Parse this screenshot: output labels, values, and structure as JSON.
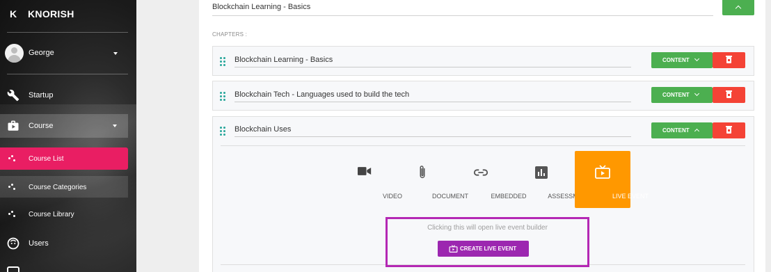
{
  "sidebar": {
    "brand_letter": "K",
    "brand_name": "KNORISH",
    "user_name": "George",
    "items": [
      {
        "label": "Startup",
        "icon": "wrench-icon"
      },
      {
        "label": "Course",
        "icon": "course-icon"
      },
      {
        "label": "Course List",
        "icon": "scatter-dots-icon"
      },
      {
        "label": "Course Categories",
        "icon": "scatter-dots-icon"
      },
      {
        "label": "Course Library",
        "icon": "scatter-dots-icon"
      },
      {
        "label": "Users",
        "icon": "face-icon"
      }
    ]
  },
  "main": {
    "course_title": "Blockchain Learning - Basics",
    "chapters_label": "CHAPTERS :",
    "chapters": [
      {
        "title": "Blockchain Learning - Basics",
        "content_label": "CONTENT"
      },
      {
        "title": "Blockchain Tech - Languages used to build the tech",
        "content_label": "CONTENT"
      },
      {
        "title": "Blockchain Uses",
        "content_label": "CONTENT"
      }
    ],
    "content_types": [
      {
        "label": "VIDEO",
        "icon": "video-camera-icon"
      },
      {
        "label": "DOCUMENT",
        "icon": "paperclip-icon"
      },
      {
        "label": "EMBEDDED",
        "icon": "link-icon"
      },
      {
        "label": "ASSESSMENT",
        "icon": "bar-chart-icon"
      },
      {
        "label": "LIVE EVENT",
        "icon": "live-tv-icon"
      }
    ],
    "selected_type": "LIVE EVENT",
    "live_hint": "Clicking this will open live event builder",
    "create_button": "CREATE LIVE EVENT"
  },
  "colors": {
    "green": "#4caf50",
    "red": "#f44336",
    "orange": "#ff9800",
    "purple": "#9c27b0",
    "pink_active": "#e91e63",
    "highlight_box": "#b428b4",
    "teal_grip": "#26a69a"
  }
}
